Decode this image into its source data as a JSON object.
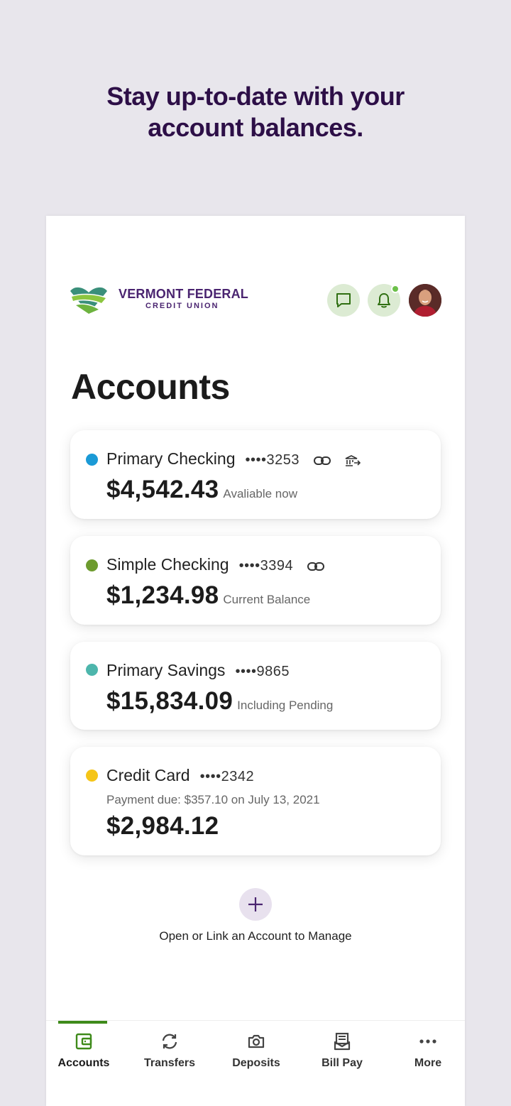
{
  "headline": {
    "line1": "Stay up-to-date with your",
    "line2": "account balances."
  },
  "brand": {
    "name_line1": "VERMONT FEDERAL",
    "name_line2": "CREDIT UNION",
    "green": "#3e8a1a",
    "purple": "#4a2470"
  },
  "page": {
    "title": "Accounts"
  },
  "accounts": [
    {
      "name": "Primary Checking",
      "mask": "••••3253",
      "amount": "$4,542.43",
      "note": "Avaliable now",
      "dot_color": "#1b9ad6",
      "icons": [
        "link-icon",
        "bank-transfer-icon"
      ]
    },
    {
      "name": "Simple Checking",
      "mask": "••••3394",
      "amount": "$1,234.98",
      "note": "Current Balance",
      "dot_color": "#6d9b2e",
      "icons": [
        "link-icon"
      ]
    },
    {
      "name": "Primary Savings",
      "mask": "••••9865",
      "amount": "$15,834.09",
      "note": "Including Pending",
      "dot_color": "#4db6ac",
      "icons": []
    },
    {
      "name": "Credit Card",
      "mask": "••••2342",
      "payment_due": "Payment due: $357.10 on July 13, 2021",
      "amount": "$2,984.12",
      "dot_color": "#f5c518",
      "icons": []
    }
  ],
  "add_account": {
    "label": "Open or Link an Account to Manage",
    "icon": "plus-icon"
  },
  "tabbar": {
    "active": "Accounts",
    "tabs": [
      {
        "label": "Accounts",
        "icon": "wallet-icon"
      },
      {
        "label": "Transfers",
        "icon": "refresh-icon"
      },
      {
        "label": "Deposits",
        "icon": "camera-icon"
      },
      {
        "label": "Bill Pay",
        "icon": "bill-icon"
      },
      {
        "label": "More",
        "icon": "more-icon"
      }
    ]
  }
}
